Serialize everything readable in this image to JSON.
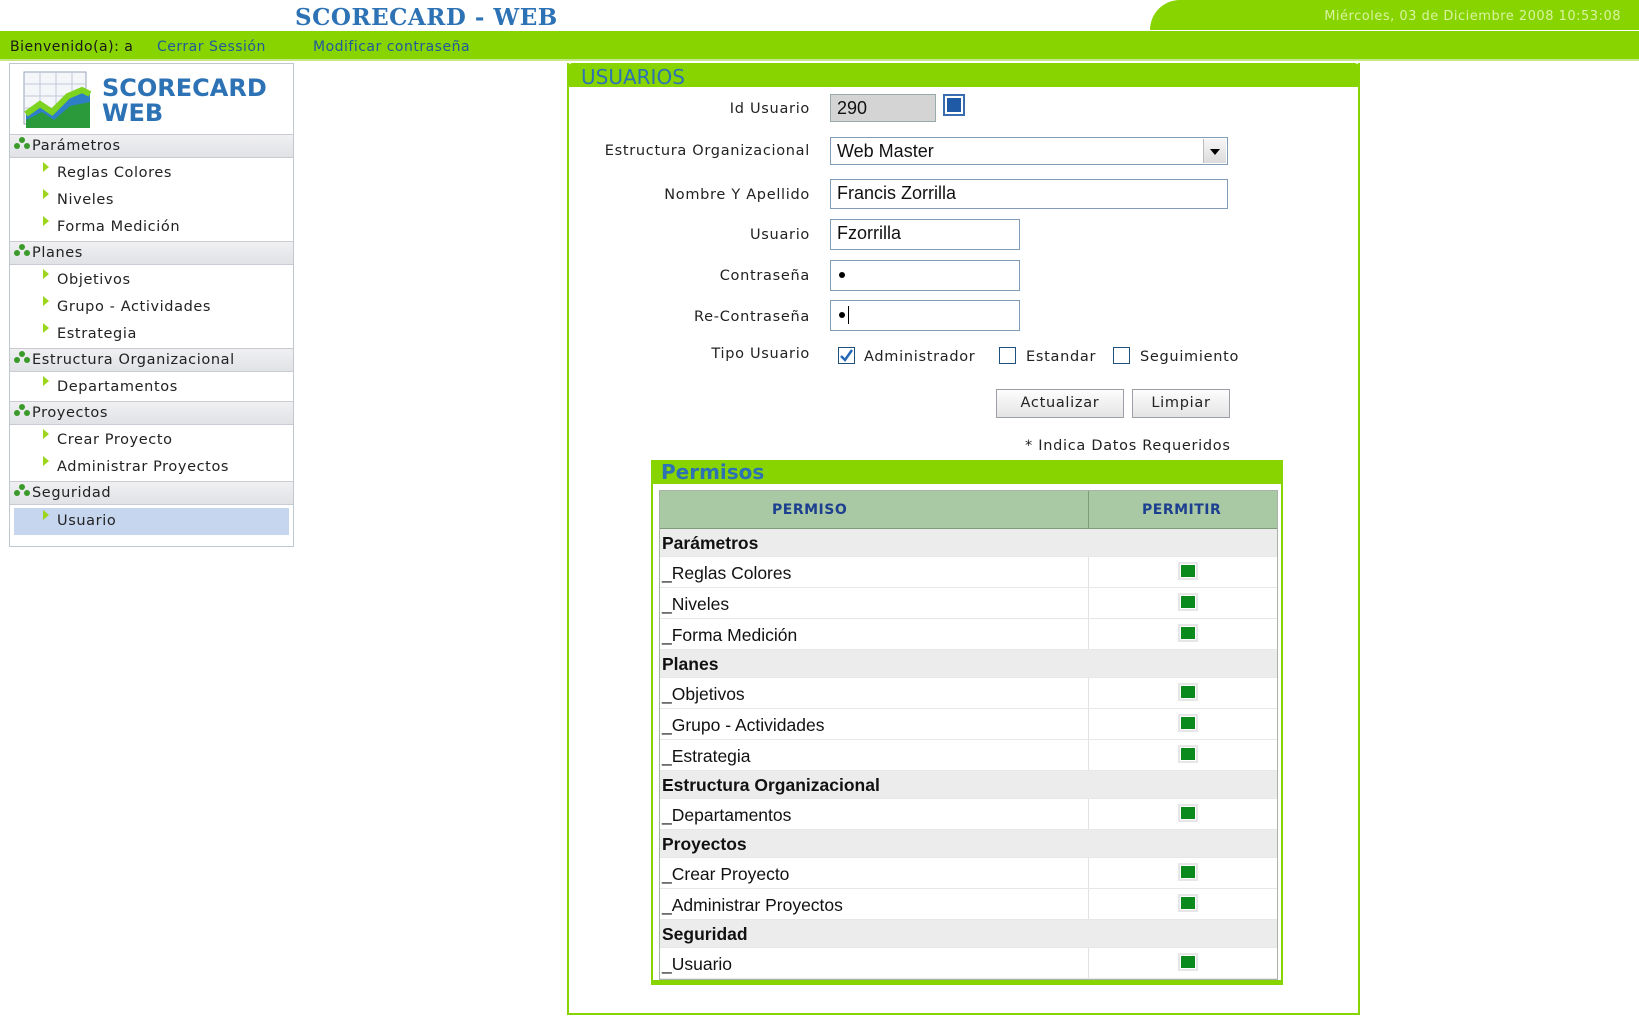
{
  "header": {
    "title": "SCORECARD - WEB",
    "datetime": "Miércoles, 03 de Diciembre 2008 10:53:08",
    "welcome": "Bienvenido(a): a",
    "logout": "Cerrar Sessión",
    "change_password": "Modificar contraseña"
  },
  "sidebar": {
    "logo_line1": "SCORECARD",
    "logo_line2": "WEB",
    "sections": [
      {
        "label": "Parámetros",
        "items": [
          "Reglas Colores",
          "Niveles",
          "Forma Medición"
        ]
      },
      {
        "label": "Planes",
        "items": [
          "Objetivos",
          "Grupo - Actividades",
          "Estrategia"
        ]
      },
      {
        "label": "Estructura Organizacional",
        "items": [
          "Departamentos"
        ]
      },
      {
        "label": "Proyectos",
        "items": [
          "Crear Proyecto",
          "Administrar Proyectos"
        ]
      },
      {
        "label": "Seguridad",
        "items": [
          "Usuario"
        ]
      }
    ],
    "active_item": "Usuario"
  },
  "form": {
    "title": "USUARIOS",
    "id_label": "Id Usuario",
    "id_value": "290",
    "estructura_label": "Estructura Organizacional",
    "estructura_value": "Web Master",
    "nombre_label": "Nombre Y Apellido",
    "nombre_value": "Francis Zorrilla",
    "usuario_label": "Usuario",
    "usuario_value": "Fzorrilla",
    "pass_label": "Contraseña",
    "repass_label": "Re-Contraseña",
    "tipo_label": "Tipo Usuario",
    "tipo_options": [
      {
        "label": "Administrador",
        "checked": true
      },
      {
        "label": "Estandar",
        "checked": false
      },
      {
        "label": "Seguimiento",
        "checked": false
      }
    ],
    "update_button": "Actualizar",
    "clear_button": "Limpiar",
    "required_note": "* Indica Datos Requeridos"
  },
  "permisos": {
    "title": "Permisos",
    "col_permiso": "PERMISO",
    "col_permitir": "PERMITIR",
    "rows": [
      {
        "name": "Parámetros",
        "group": true
      },
      {
        "name": "_Reglas Colores",
        "group": false,
        "allowed": true
      },
      {
        "name": "_Niveles",
        "group": false,
        "allowed": true
      },
      {
        "name": "_Forma Medición",
        "group": false,
        "allowed": true
      },
      {
        "name": "Planes",
        "group": true
      },
      {
        "name": "_Objetivos",
        "group": false,
        "allowed": true
      },
      {
        "name": "_Grupo - Actividades",
        "group": false,
        "allowed": true
      },
      {
        "name": "_Estrategia",
        "group": false,
        "allowed": true
      },
      {
        "name": "Estructura Organizacional",
        "group": true
      },
      {
        "name": "_Departamentos",
        "group": false,
        "allowed": true
      },
      {
        "name": "Proyectos",
        "group": true
      },
      {
        "name": "_Crear Proyecto",
        "group": false,
        "allowed": true
      },
      {
        "name": "_Administrar Proyectos",
        "group": false,
        "allowed": true
      },
      {
        "name": "Seguridad",
        "group": true
      },
      {
        "name": "_Usuario",
        "group": false,
        "allowed": true
      }
    ]
  },
  "colors": {
    "accent_green": "#88d400",
    "brand_blue": "#2d72b4",
    "check_green": "#0a8a1c"
  }
}
